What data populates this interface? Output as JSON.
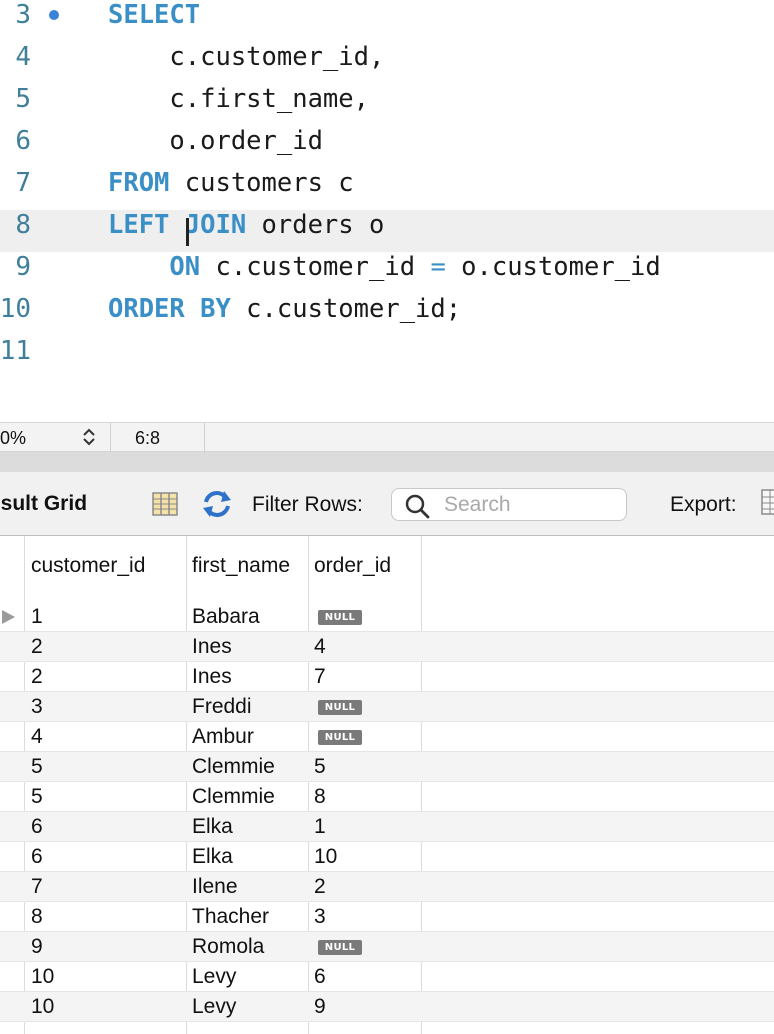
{
  "editor": {
    "lines": [
      {
        "num": "3",
        "tokens": [
          {
            "t": "SELECT",
            "k": "kw"
          }
        ],
        "breakpoint": true
      },
      {
        "num": "4",
        "tokens": [
          {
            "t": "    c.customer_id,",
            "k": ""
          }
        ]
      },
      {
        "num": "5",
        "tokens": [
          {
            "t": "    c.first_name,",
            "k": ""
          }
        ]
      },
      {
        "num": "6",
        "tokens": [
          {
            "t": "    o.order_id",
            "k": ""
          }
        ]
      },
      {
        "num": "7",
        "tokens": [
          {
            "t": "FROM",
            "k": "kw"
          },
          {
            "t": " customers c",
            "k": ""
          }
        ]
      },
      {
        "num": "8",
        "tokens": [
          {
            "t": "LEFT JOIN",
            "k": "kw"
          },
          {
            "t": " orders o",
            "k": ""
          }
        ],
        "current": true
      },
      {
        "num": "9",
        "tokens": [
          {
            "t": "    ",
            "k": ""
          },
          {
            "t": "ON",
            "k": "kw"
          },
          {
            "t": " c.customer_id ",
            "k": ""
          },
          {
            "t": "=",
            "k": "op"
          },
          {
            "t": " o.customer_id",
            "k": ""
          }
        ]
      },
      {
        "num": "10",
        "tokens": [
          {
            "t": "ORDER BY",
            "k": "kw"
          },
          {
            "t": " c.customer_id;",
            "k": ""
          }
        ]
      },
      {
        "num": "11",
        "tokens": []
      }
    ]
  },
  "status": {
    "zoom": "0%",
    "cursor_position": "6:8"
  },
  "toolbar": {
    "result_grid_label": "esult Grid",
    "filter_label": "Filter Rows:",
    "search_placeholder": "Search",
    "export_label": "Export:"
  },
  "grid": {
    "columns": [
      "customer_id",
      "first_name",
      "order_id"
    ],
    "null_label": "NULL",
    "rows": [
      [
        "1",
        "Babara",
        null
      ],
      [
        "2",
        "Ines",
        "4"
      ],
      [
        "2",
        "Ines",
        "7"
      ],
      [
        "3",
        "Freddi",
        null
      ],
      [
        "4",
        "Ambur",
        null
      ],
      [
        "5",
        "Clemmie",
        "5"
      ],
      [
        "5",
        "Clemmie",
        "8"
      ],
      [
        "6",
        "Elka",
        "1"
      ],
      [
        "6",
        "Elka",
        "10"
      ],
      [
        "7",
        "Ilene",
        "2"
      ],
      [
        "8",
        "Thacher",
        "3"
      ],
      [
        "9",
        "Romola",
        null
      ],
      [
        "10",
        "Levy",
        "6"
      ],
      [
        "10",
        "Levy",
        "9"
      ]
    ]
  }
}
